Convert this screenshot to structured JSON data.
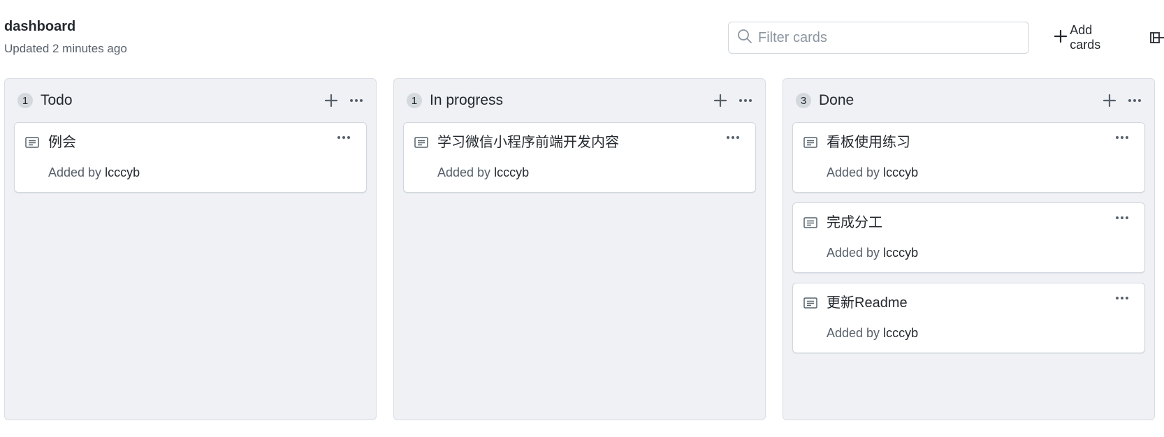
{
  "header": {
    "title": "dashboard",
    "updated": "Updated 2 minutes ago",
    "filter_placeholder": "Filter cards",
    "add_cards_label": "Add cards"
  },
  "columns": [
    {
      "count": "1",
      "name": "Todo",
      "cards": [
        {
          "title": "例会",
          "added_by_label": "Added by",
          "author": "lcccyb"
        }
      ]
    },
    {
      "count": "1",
      "name": "In progress",
      "cards": [
        {
          "title": "学习微信小程序前端开发内容",
          "added_by_label": "Added by",
          "author": "lcccyb"
        }
      ]
    },
    {
      "count": "3",
      "name": "Done",
      "cards": [
        {
          "title": "看板使用练习",
          "added_by_label": "Added by",
          "author": "lcccyb"
        },
        {
          "title": "完成分工",
          "added_by_label": "Added by",
          "author": "lcccyb"
        },
        {
          "title": "更新Readme",
          "added_by_label": "Added by",
          "author": "lcccyb"
        }
      ]
    }
  ],
  "icons": {
    "search": "search-icon",
    "plus": "plus-icon",
    "kebab": "kebab-horizontal-icon",
    "note": "note-icon",
    "layout": "layout-icon"
  },
  "colors": {
    "column_bg": "#eff1f4",
    "border": "#d0d7de",
    "muted_text": "#57606a",
    "badge_bg": "#d4d9de"
  }
}
